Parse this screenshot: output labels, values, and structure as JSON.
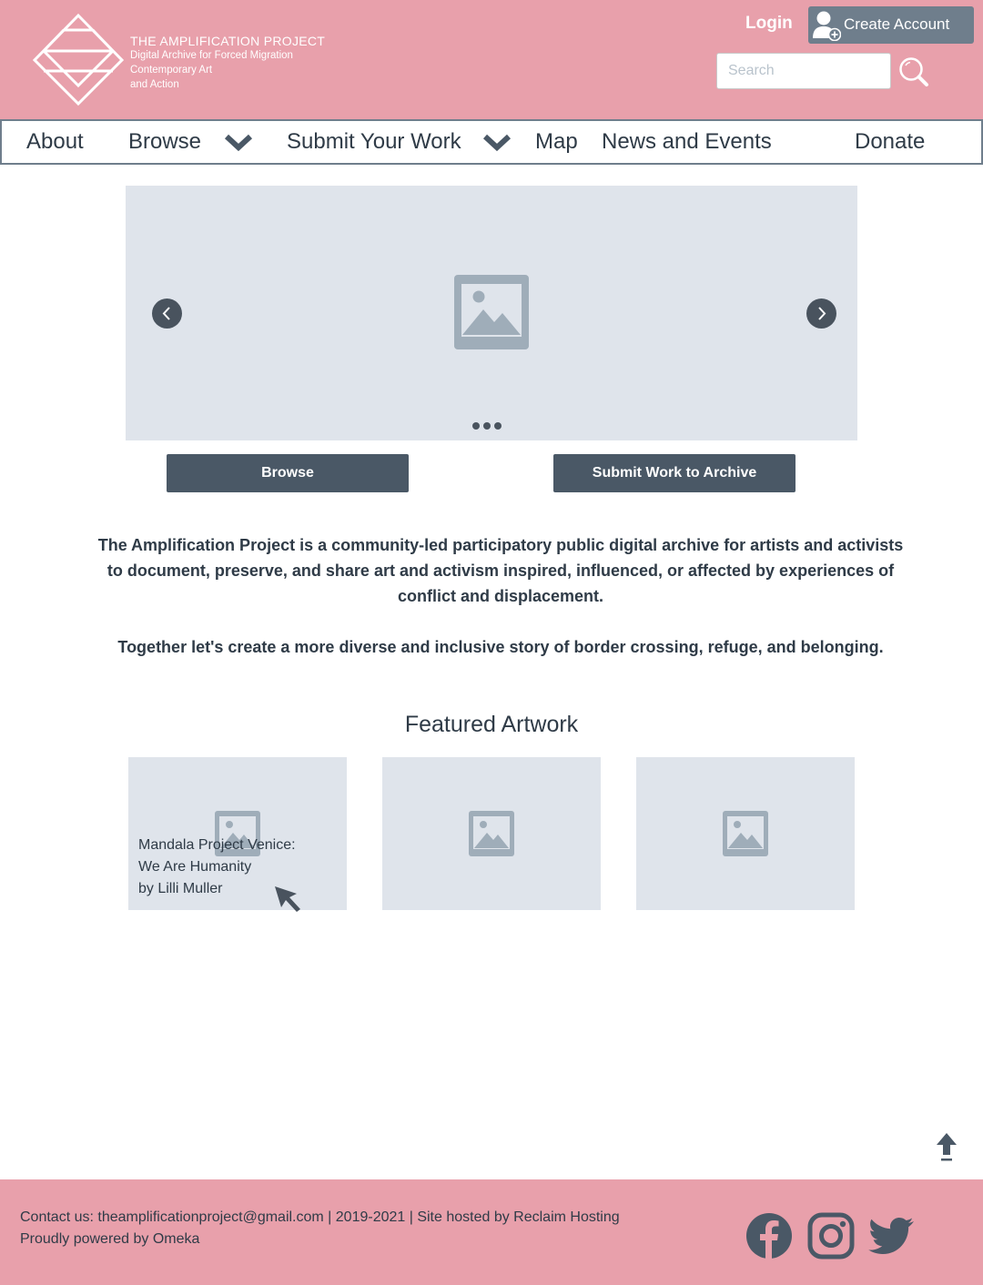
{
  "header": {
    "logo_title": "THE AMPLIFICATION PROJECT",
    "logo_lines": [
      "Digital Archive for Forced Migration",
      "Contemporary Art",
      "and Action"
    ],
    "login_label": "Login",
    "create_account_label": "Create Account",
    "search_placeholder": "Search",
    "search_value": ""
  },
  "nav": {
    "items": [
      {
        "label": "About",
        "dropdown": false
      },
      {
        "label": "Browse",
        "dropdown": true
      },
      {
        "label": "Submit Your Work",
        "dropdown": true
      },
      {
        "label": "Map",
        "dropdown": false
      },
      {
        "label": "News and Events",
        "dropdown": false
      },
      {
        "label": "Donate",
        "dropdown": false
      }
    ]
  },
  "carousel": {
    "slide_count": 3,
    "prev_icon": "chevron-left-icon",
    "next_icon": "chevron-right-icon",
    "image_icon": "image-placeholder-icon"
  },
  "actions": {
    "browse_label": "Browse",
    "submit_label": "Submit Work to Archive"
  },
  "intro": {
    "text": "The Amplification Project is a community-led participatory public digital archive for artists and activists to document, preserve, and share art and activism inspired, influenced, or affected by experiences of conflict and displacement.",
    "tagline": "Together let's create a more diverse and inclusive story of border crossing, refuge, and belonging."
  },
  "featured": {
    "title": "Featured Artwork",
    "cards": [
      {
        "caption_lines": [
          "Mandala Project Venice:",
          "We Are Humanity",
          "by Lilli Muller"
        ]
      },
      {
        "caption_lines": []
      },
      {
        "caption_lines": []
      }
    ]
  },
  "footer": {
    "line1": "Contact us: theamplificationproject@gmail.com | 2019-2021 | Site hosted by Reclaim Hosting",
    "line2": "Proudly powered by Omeka",
    "social": [
      "facebook-icon",
      "instagram-icon",
      "twitter-icon"
    ]
  },
  "colors": {
    "brand_pink": "#e8a0ab",
    "slate": "#4a5866",
    "placeholder_bg": "#dfe4eb",
    "text": "#2f3b47"
  }
}
